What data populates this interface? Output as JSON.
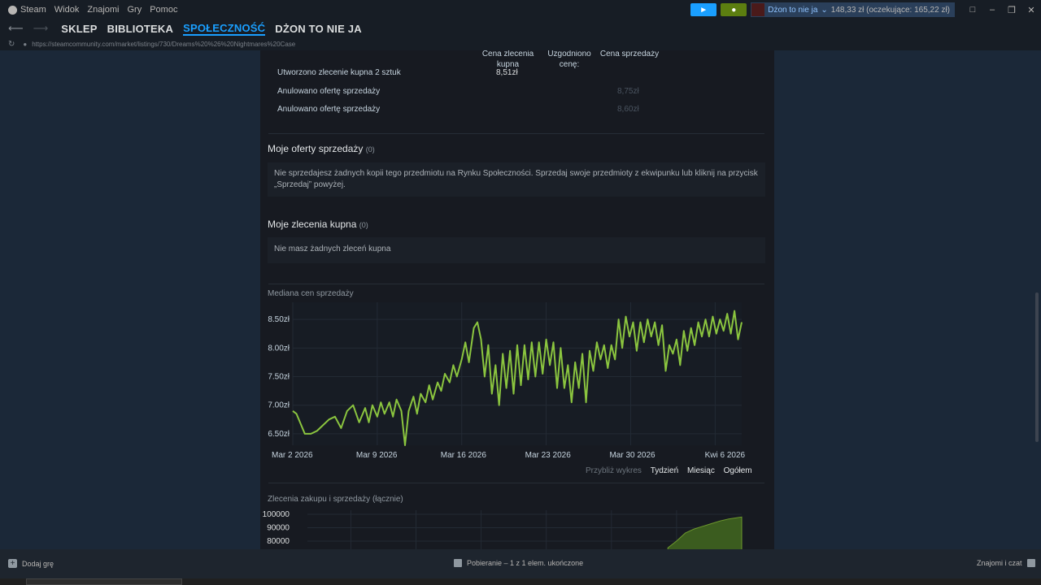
{
  "menubar": {
    "app": "Steam",
    "items": [
      "Widok",
      "Znajomi",
      "Gry",
      "Pomoc"
    ],
    "username": "Dżon to nie ja",
    "wallet": "148,33 zł (oczekujące: 165,22 zł)"
  },
  "nav": {
    "items": [
      "SKLEP",
      "BIBLIOTEKA",
      "SPOŁECZNOŚĆ",
      "DŻON TO NIE JA"
    ],
    "active_index": 2
  },
  "url": "https://steamcommunity.com/market/listings/730/Dreams%20%26%20Nightmares%20Case",
  "history": {
    "headers": {
      "buy_price": "Cena zlecenia kupna",
      "agreed_price": "Uzgodniono cenę:",
      "sell_price": "Cena sprzedaży"
    },
    "rows": [
      {
        "label": "Utworzono zlecenie kupna 2 sztuk",
        "buy": "8,51zł",
        "sell": ""
      },
      {
        "label": "Anulowano ofertę sprzedaży",
        "buy": "",
        "sell": "8,75zł"
      },
      {
        "label": "Anulowano ofertę sprzedaży",
        "buy": "",
        "sell": "8,60zł"
      }
    ]
  },
  "my_listings": {
    "title": "Moje oferty sprzedaży",
    "count": "(0)",
    "text": "Nie sprzedajesz żadnych kopii tego przedmiotu na Rynku Społeczności. Sprzedaj swoje przedmioty z ekwipunku lub kliknij na przycisk „Sprzedaj” powyżej."
  },
  "my_buy_orders": {
    "title": "Moje zlecenia kupna",
    "count": "(0)",
    "text": "Nie masz żadnych zleceń kupna"
  },
  "chart_data": [
    {
      "type": "line",
      "title": "Mediana cen sprzedaży",
      "x_tick_labels": [
        "Mar 2 2026",
        "Mar 9 2026",
        "Mar 16 2026",
        "Mar 23 2026",
        "Mar 30 2026",
        "Kwi 6 2026"
      ],
      "y_tick_labels": [
        "6.50zł",
        "7.00zł",
        "7.50zł",
        "8.00zł",
        "8.50zł"
      ],
      "ylim": [
        6.3,
        8.8
      ],
      "grid": true,
      "line_color": "#8bc53f",
      "series": [
        {
          "x_days": [
            0,
            0.3,
            0.6,
            1,
            1.5,
            2,
            2.5,
            3,
            3.5,
            4,
            4.5,
            5,
            5.5,
            6,
            6.3,
            6.6,
            7,
            7.3,
            7.6,
            8,
            8.3,
            8.6,
            9,
            9.3,
            9.6,
            10,
            10.3,
            10.6,
            11,
            11.3,
            11.6,
            12,
            12.3,
            12.6,
            13,
            13.3,
            13.6,
            14,
            14.3,
            14.6,
            15,
            15.3,
            15.6,
            15.9,
            16.2,
            16.5,
            16.8,
            17.1,
            17.4,
            17.7,
            18,
            18.3,
            18.6,
            18.9,
            19.2,
            19.5,
            19.8,
            20.1,
            20.4,
            20.7,
            21,
            21.3,
            21.6,
            21.9,
            22.2,
            22.5,
            22.8,
            23.1,
            23.4,
            23.7,
            24,
            24.3,
            24.6,
            24.9,
            25.2,
            25.5,
            25.8,
            26.1,
            26.4,
            26.7,
            27,
            27.3,
            27.6,
            27.9,
            28.2,
            28.5,
            28.8,
            29.1,
            29.4,
            29.7,
            30,
            30.3,
            30.6,
            30.9,
            31.2,
            31.5,
            31.8,
            32.1,
            32.4,
            32.7,
            33,
            33.3,
            33.6,
            33.9,
            34.2,
            34.5,
            34.8,
            35.1,
            35.4,
            35.7,
            36,
            36.3,
            36.6,
            36.9,
            37.2
          ],
          "values": [
            6.9,
            6.85,
            6.7,
            6.5,
            6.5,
            6.55,
            6.65,
            6.75,
            6.8,
            6.6,
            6.9,
            7.0,
            6.7,
            6.95,
            6.7,
            7.0,
            6.8,
            7.05,
            6.85,
            7.05,
            6.8,
            7.1,
            6.9,
            6.3,
            6.9,
            7.15,
            6.85,
            7.2,
            7.05,
            7.35,
            7.1,
            7.4,
            7.25,
            7.55,
            7.4,
            7.7,
            7.5,
            7.8,
            8.1,
            7.75,
            8.35,
            8.45,
            8.15,
            7.5,
            8.05,
            7.2,
            7.7,
            7.0,
            7.9,
            7.3,
            7.95,
            7.2,
            8.05,
            7.35,
            8.05,
            7.45,
            8.1,
            7.5,
            8.1,
            7.55,
            8.15,
            7.7,
            8.1,
            7.3,
            8.0,
            7.3,
            7.7,
            7.05,
            7.75,
            7.3,
            7.9,
            7.05,
            7.95,
            7.6,
            8.1,
            7.8,
            8.05,
            7.65,
            8.05,
            7.8,
            8.5,
            8.0,
            8.55,
            8.2,
            8.45,
            7.95,
            8.45,
            8.1,
            8.5,
            8.2,
            8.45,
            8.05,
            8.4,
            7.6,
            8.05,
            7.9,
            8.15,
            7.7,
            8.3,
            7.95,
            8.35,
            8.05,
            8.45,
            8.2,
            8.5,
            8.2,
            8.55,
            8.25,
            8.5,
            8.3,
            8.6,
            8.25,
            8.65,
            8.15,
            8.45
          ]
        }
      ]
    },
    {
      "type": "area",
      "title": "Zlecenia zakupu i sprzedaży (łącznie)",
      "y_tick_labels": [
        "100000",
        "90000",
        "80000"
      ],
      "ylim": [
        75000,
        103000
      ],
      "grid": true,
      "fill_color": "#3b5c1f",
      "line_color": "#6e9a2d",
      "series": [
        {
          "x_frac": [
            0.83,
            0.85,
            0.87,
            0.89,
            0.91,
            0.93,
            0.95,
            0.97,
            1.0
          ],
          "values": [
            75000,
            80000,
            86000,
            89000,
            91000,
            93000,
            95000,
            96500,
            98000
          ]
        }
      ]
    }
  ],
  "zoom": {
    "label": "Przybliż wykres",
    "options": [
      "Tydzień",
      "Miesiąc",
      "Ogółem"
    ]
  },
  "status": {
    "add_game": "Dodaj grę",
    "downloads": "Pobieranie – 1 z 1 elem. ukończone",
    "friends": "Znajomi i czat"
  }
}
